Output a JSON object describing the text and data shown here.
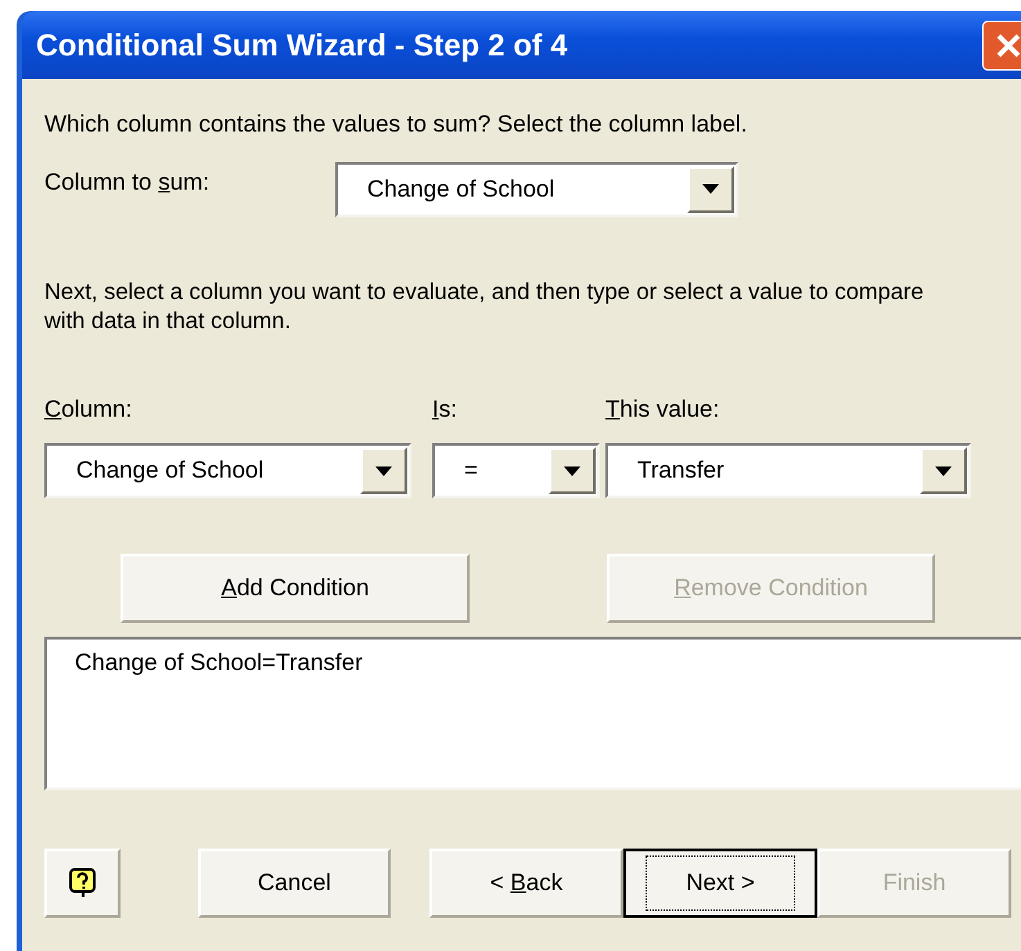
{
  "window": {
    "title": "Conditional Sum Wizard - Step 2 of 4"
  },
  "instruction": "Which column contains the values to sum? Select the column label.",
  "sum_column": {
    "label": {
      "pre": "Column to ",
      "key": "s",
      "post": "um:"
    },
    "value": "Change of School"
  },
  "paragraph": "Next, select a column you want to evaluate, and then type or select a value to compare with data in that column.",
  "condition_fields": [
    {
      "label": {
        "key": "C",
        "post": "olumn:"
      },
      "value": "Change of School"
    },
    {
      "label": {
        "key": "I",
        "post": "s:"
      },
      "value": "="
    },
    {
      "label": {
        "key": "T",
        "post": "his value:"
      },
      "value": "Transfer"
    }
  ],
  "condition_buttons": [
    {
      "label": {
        "key": "A",
        "post": "dd Condition"
      },
      "disabled": false
    },
    {
      "label": {
        "key": "R",
        "post": "emove Condition"
      },
      "disabled": true
    }
  ],
  "conditions_list": [
    "Change of School=Transfer"
  ],
  "footer_buttons": [
    {
      "kind": "help"
    },
    {
      "kind": "text",
      "label": {
        "pre": "Cancel"
      },
      "disabled": false,
      "default": false
    },
    {
      "kind": "text",
      "label": {
        "pre": "< ",
        "key": "B",
        "post": "ack"
      },
      "disabled": false,
      "default": false
    },
    {
      "kind": "text",
      "label": {
        "pre": "Next >"
      },
      "disabled": false,
      "default": true
    },
    {
      "kind": "text",
      "label": {
        "pre": "Finish"
      },
      "disabled": true,
      "default": false
    }
  ]
}
